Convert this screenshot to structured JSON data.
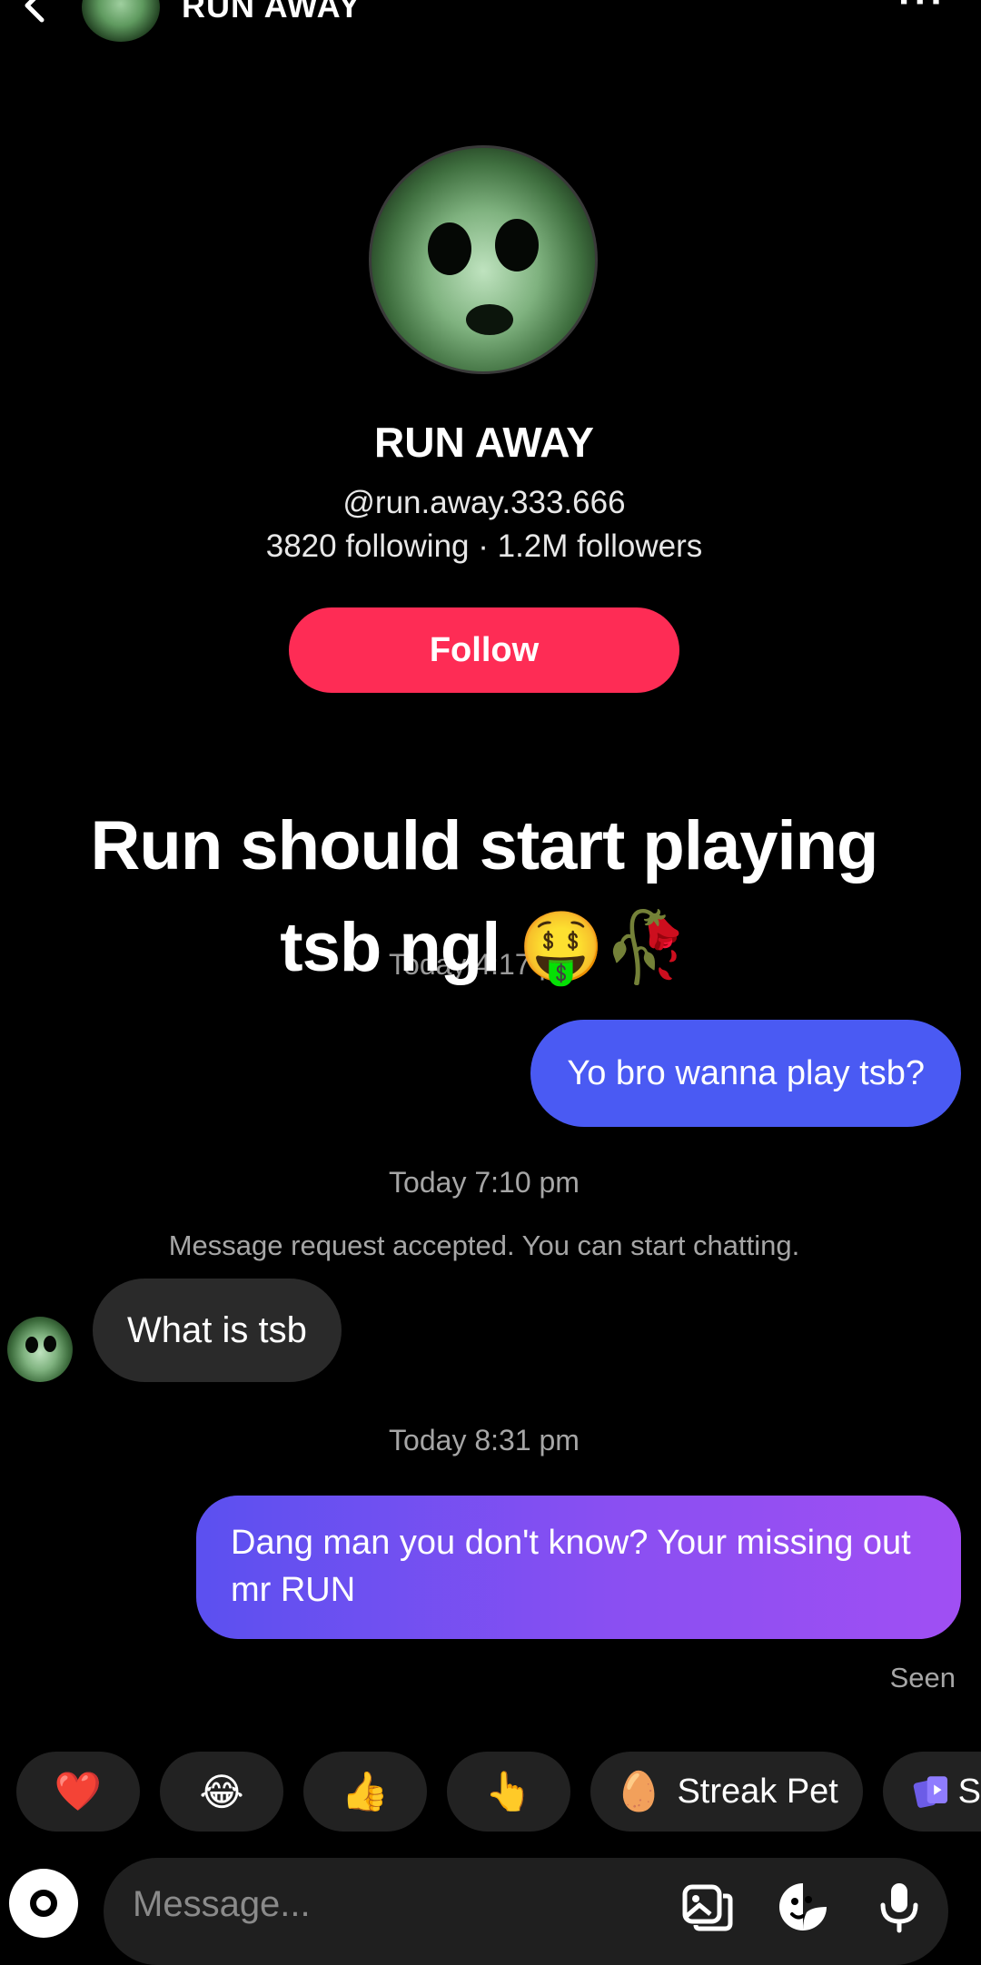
{
  "header": {
    "title": "RUN AWAY",
    "back_icon": "chevron-left-icon",
    "more_icon": "more-horizontal-icon"
  },
  "profile": {
    "name": "RUN AWAY",
    "handle": "@run.away.333.666",
    "stats": "3820 following · 1.2M followers",
    "follow_label": "Follow",
    "follow_color": "#fe2c55"
  },
  "caption": {
    "line1": "Run should start playing",
    "line2": "tsb ngl 🤑🥀"
  },
  "messages": {
    "partial_timestamp": "Today 4:17 p...",
    "outgoing_1": "Yo bro wanna play tsb?",
    "timestamp_1": "Today 7:10 pm",
    "system": "Message request accepted. You can start chatting.",
    "incoming_1": "What is tsb",
    "timestamp_2": "Today 8:31 pm",
    "outgoing_2": "Dang man you don't know? Your missing out mr RUN",
    "status": "Seen",
    "outgoing_color": "#4a5af3"
  },
  "quick_reactions": {
    "heart": "❤️",
    "laugh": "😂",
    "thumbs_up": "👍",
    "point": "👆",
    "streak_pet_emoji": "🥚",
    "streak_pet_label": "Streak Pet",
    "sticker_label": "S"
  },
  "composer": {
    "placeholder": "Message...",
    "icons": [
      "camera-icon",
      "image-icon",
      "sticker-icon",
      "microphone-icon"
    ]
  }
}
